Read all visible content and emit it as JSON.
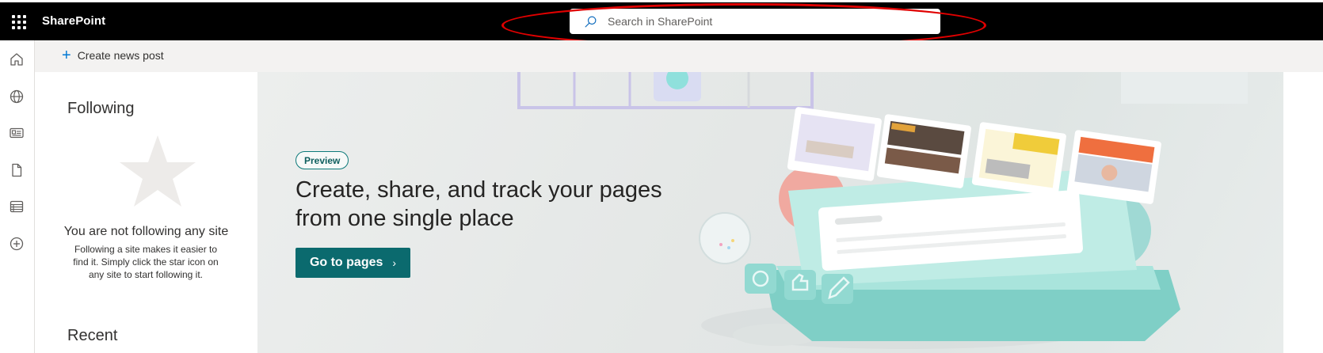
{
  "topbar": {
    "app_name": "SharePoint",
    "search_placeholder": "Search in SharePoint"
  },
  "leftrail": {
    "icons": [
      "home-icon",
      "globe-icon",
      "news-icon",
      "document-icon",
      "list-icon",
      "add-circle-icon"
    ]
  },
  "commandbar": {
    "create_news_post": "Create news post"
  },
  "following_panel": {
    "title": "Following",
    "empty_title": "You are not following any site",
    "empty_description": "Following a site makes it easier to find it. Simply click the star icon on any site to start following it.",
    "recent_title": "Recent"
  },
  "hero": {
    "badge": "Preview",
    "title": "Create, share, and track your pages from one single place",
    "button_label": "Go to pages"
  },
  "colors": {
    "topbar": "#000000",
    "accent": "#0b6a6e",
    "highlight_annotation": "#e00000"
  }
}
